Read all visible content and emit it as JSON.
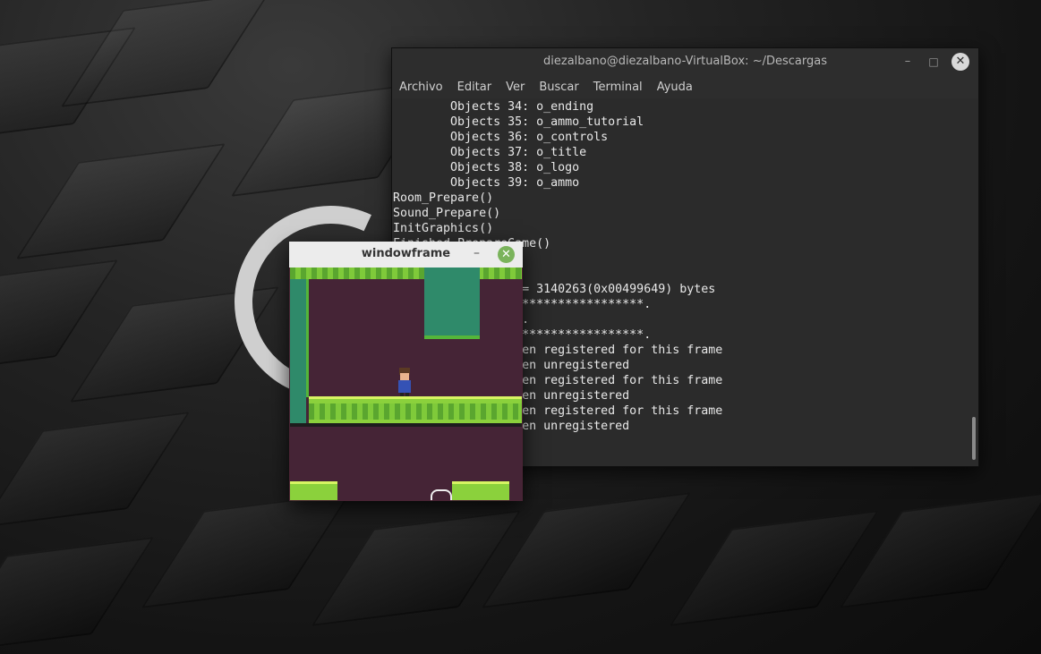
{
  "terminal": {
    "title": "diezalbano@diezalbano-VirtualBox: ~/Descargas",
    "controls": {
      "minimize": "–",
      "maximize": "□",
      "close": "✕"
    },
    "menu": [
      "Archivo",
      "Editar",
      "Ver",
      "Buscar",
      "Terminal",
      "Ayuda"
    ],
    "lines": [
      "\tObjects 34: o_ending",
      "\tObjects 35: o_ammo_tutorial",
      "\tObjects 36: o_controls",
      "\tObjects 37: o_title",
      "\tObjects 38: o_logo",
      "\tObjects 39: o_ammo",
      "Room_Prepare()",
      "Sound_Prepare()",
      "InitGraphics()",
      "Finished PrepareGame()",
      "",
      "",
      "                  = 3140263(0x00499649) bytes",
      "                  *****************.",
      "                  .",
      "                  *****************.",
      "                  en registered for this frame",
      "                  en unregistered",
      "                  en registered for this frame",
      "                  en unregistered",
      "                  en registered for this frame",
      "                  en unregistered"
    ]
  },
  "game": {
    "title": "windowframe",
    "controls": {
      "minimize": "–",
      "close": "✕"
    },
    "colors": {
      "background": "#452436",
      "grass": "#8bd13c",
      "wall": "#2f8a6a"
    }
  }
}
